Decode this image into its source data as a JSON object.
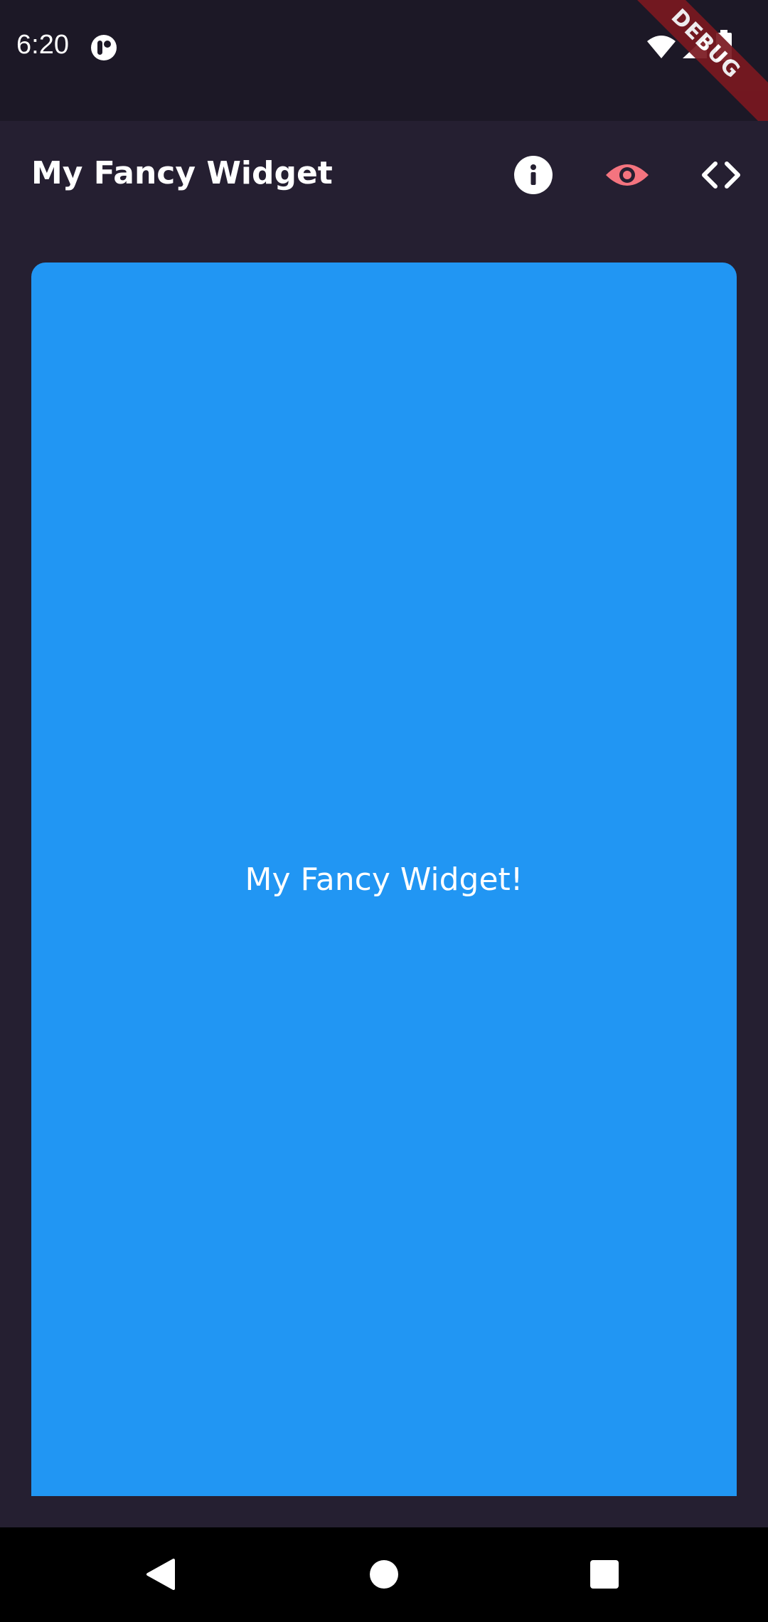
{
  "status_bar": {
    "time": "6:20",
    "app_icon": "notification-app-icon",
    "icons": [
      "wifi-icon",
      "signal-icon",
      "battery-icon"
    ],
    "debug_label": "DEBUG"
  },
  "app_bar": {
    "title": "My Fancy Widget",
    "actions": [
      {
        "name": "info",
        "icon": "info-icon",
        "color": "#ffffff"
      },
      {
        "name": "preview",
        "icon": "eye-icon",
        "color": "#f4747f"
      },
      {
        "name": "code",
        "icon": "code-icon",
        "color": "#ffffff"
      }
    ]
  },
  "widget": {
    "text": "My Fancy Widget!",
    "color": "#2196f3"
  },
  "nav_bar": {
    "buttons": [
      "back-icon",
      "home-icon",
      "recents-icon"
    ]
  },
  "colors": {
    "background": "#251f31",
    "status_bar": "#1c1826",
    "accent": "#f4747f",
    "card": "#2196f3"
  }
}
